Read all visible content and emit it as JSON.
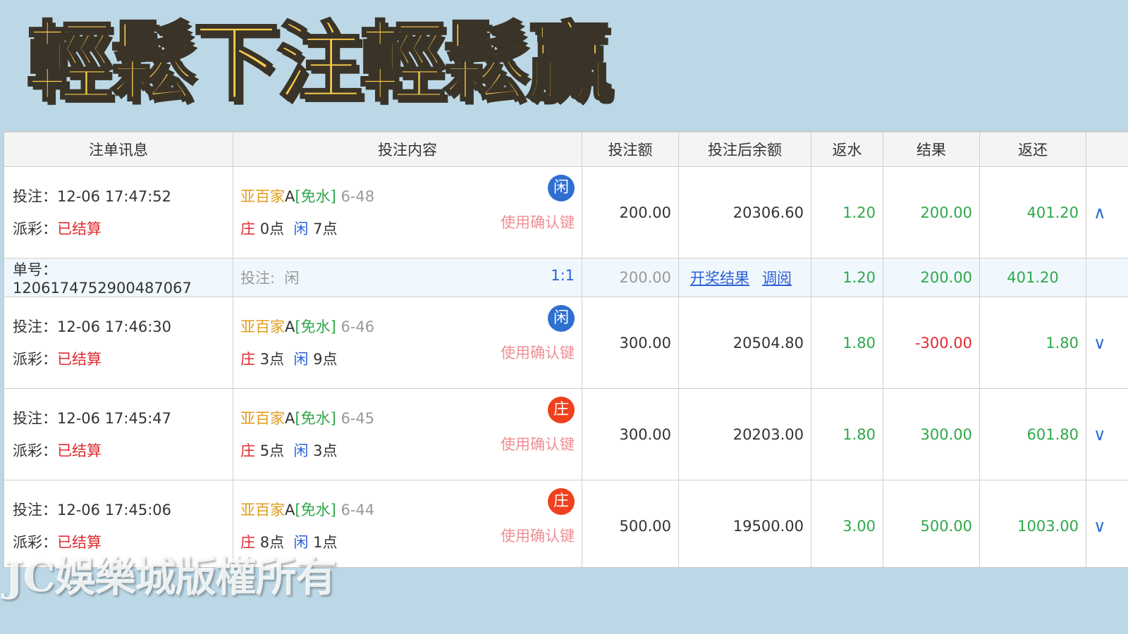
{
  "banner": "輕鬆下注輕鬆贏",
  "watermark": "JC娛樂城版權所有",
  "headers": [
    "注单讯息",
    "投注内容",
    "投注额",
    "投注后余额",
    "返水",
    "结果",
    "返还"
  ],
  "labels": {
    "bet_time": "投注：",
    "payout": "派彩：",
    "order_no": "单号：",
    "bet_on": "投注:",
    "banker_word": "庄",
    "player_word": "闲",
    "points_word": "点",
    "confirm": "使用确认键",
    "game_prefix": "亚百家",
    "game_letter": "A",
    "game_bracket": "[免水]"
  },
  "rows": [
    {
      "time": "12-06 17:47:52",
      "status": "已结算",
      "round": "6-48",
      "mark": "闲",
      "banker_pts": "0",
      "player_pts": "7",
      "amount": "200.00",
      "balance": "20306.60",
      "rebate": "1.20",
      "result": "200.00",
      "result_color": "green",
      "return": "401.20",
      "arrow": "∧"
    },
    {
      "time": "12-06 17:46:30",
      "status": "已结算",
      "round": "6-46",
      "mark": "闲",
      "banker_pts": "3",
      "player_pts": "9",
      "amount": "300.00",
      "balance": "20504.80",
      "rebate": "1.80",
      "result": "-300.00",
      "result_color": "red",
      "return": "1.80",
      "arrow": "∨"
    },
    {
      "time": "12-06 17:45:47",
      "status": "已结算",
      "round": "6-45",
      "mark": "庄",
      "banker_pts": "5",
      "player_pts": "3",
      "amount": "300.00",
      "balance": "20203.00",
      "rebate": "1.80",
      "result": "300.00",
      "result_color": "green",
      "return": "601.80",
      "arrow": "∨"
    },
    {
      "time": "12-06 17:45:06",
      "status": "已结算",
      "round": "6-44",
      "mark": "庄",
      "banker_pts": "8",
      "player_pts": "1",
      "amount": "500.00",
      "balance": "19500.00",
      "rebate": "3.00",
      "result": "500.00",
      "result_color": "green",
      "return": "1003.00",
      "arrow": "∨"
    }
  ],
  "detail": {
    "order_no": "1206174752900487067",
    "bet_side": "闲",
    "ratio": "1:1",
    "amount": "200.00",
    "link_result": "开奖结果",
    "link_review": "调阅",
    "rebate": "1.20",
    "result": "200.00",
    "return": "401.20"
  },
  "colors": {
    "banner_fill": "#f9cd4a",
    "background": "#bcd8e6",
    "win_green": "#2ea84a",
    "loss_red": "#e0292e",
    "player_blue": "#2e6fd0",
    "banker_red": "#f0401e"
  }
}
